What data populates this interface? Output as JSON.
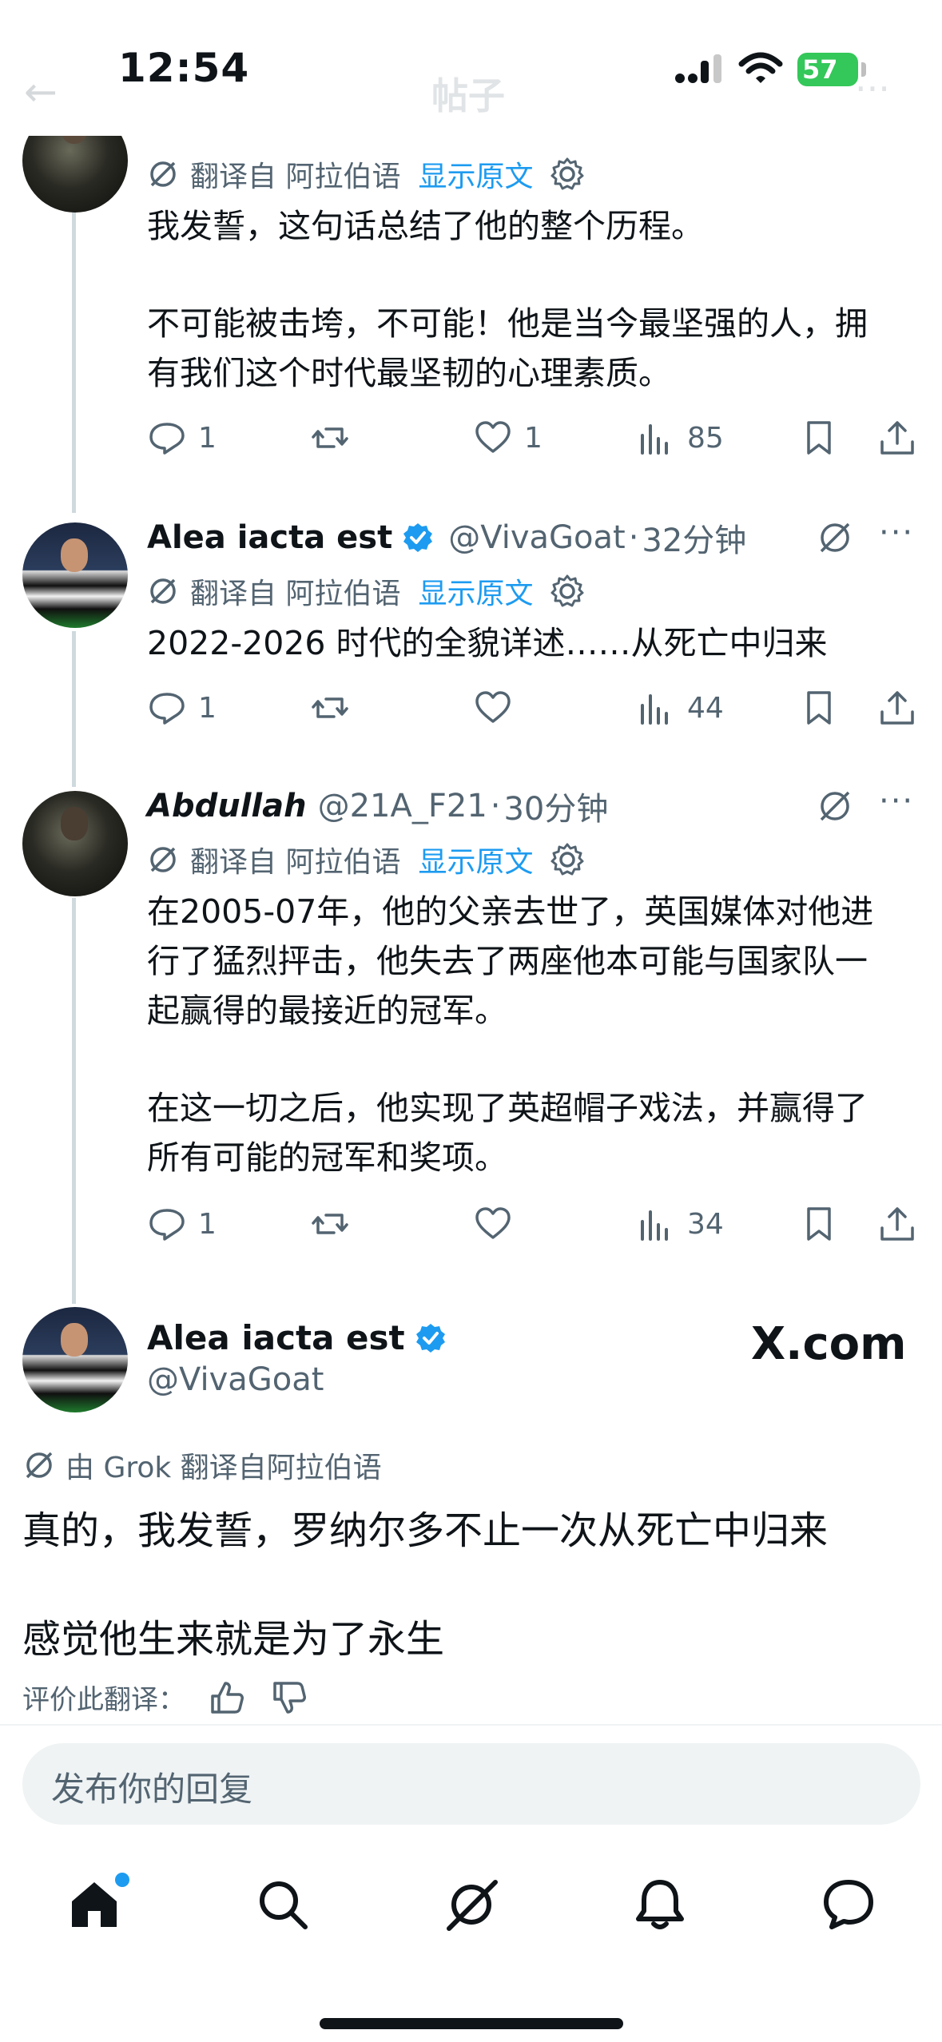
{
  "status_bar": {
    "time": "12:54",
    "battery": "57"
  },
  "ghost_header": {
    "title": "帖子",
    "back": "←",
    "more": "···"
  },
  "thread": [
    {
      "id": "tweet1",
      "translate_label": "翻译自 阿拉伯语",
      "show_original": "显示原文",
      "paragraphs": [
        "我发誓，这句话总结了他的整个历程。",
        "不可能被击垮，不可能！他是当今最坚强的人，拥有我们这个时代最坚韧的心理素质。"
      ],
      "reply_count": "1",
      "repost_count": "",
      "like_count": "1",
      "view_count": "85"
    },
    {
      "id": "tweet2",
      "display_name": "Alea iacta est",
      "handle": "@VivaGoat",
      "time": "32分钟",
      "translate_label": "翻译自 阿拉伯语",
      "show_original": "显示原文",
      "paragraphs": [
        "2022-2026 时代的全貌详述……从死亡中归来"
      ],
      "reply_count": "1",
      "repost_count": "",
      "like_count": "",
      "view_count": "44"
    },
    {
      "id": "tweet3",
      "display_name": "Abdullah",
      "handle": "@21A_F21",
      "time": "30分钟",
      "translate_label": "翻译自 阿拉伯语",
      "show_original": "显示原文",
      "paragraphs": [
        "在2005-07年，他的父亲去世了，英国媒体对他进行了猛烈抨击，他失去了两座他本可能与国家队一起赢得的最接近的冠军。",
        "在这一切之后，他实现了英超帽子戏法，并赢得了所有可能的冠军和奖项。"
      ],
      "reply_count": "1",
      "repost_count": "",
      "like_count": "",
      "view_count": "34"
    }
  ],
  "main_tweet": {
    "display_name": "Alea iacta est",
    "handle": "@VivaGoat",
    "watermark": "X.com",
    "grok_translate": "由 Grok 翻译自阿拉伯语",
    "line1": "真的，我发誓，罗纳尔多不止一次从死亡中归来",
    "line2": "感觉他生来就是为了永生",
    "rate_label": "评价此翻译："
  },
  "reply_box": {
    "placeholder": "发布你的回复"
  },
  "colors": {
    "accent": "#1d9bf0",
    "text": "#0f1419",
    "muted": "#536471",
    "thread_line": "#cfd9de"
  },
  "icons": [
    "reply-icon",
    "repost-icon",
    "like-icon",
    "views-icon",
    "bookmark-icon",
    "share-icon",
    "grok-icon",
    "gear-icon",
    "home-icon",
    "search-icon",
    "bell-icon",
    "messages-icon"
  ]
}
